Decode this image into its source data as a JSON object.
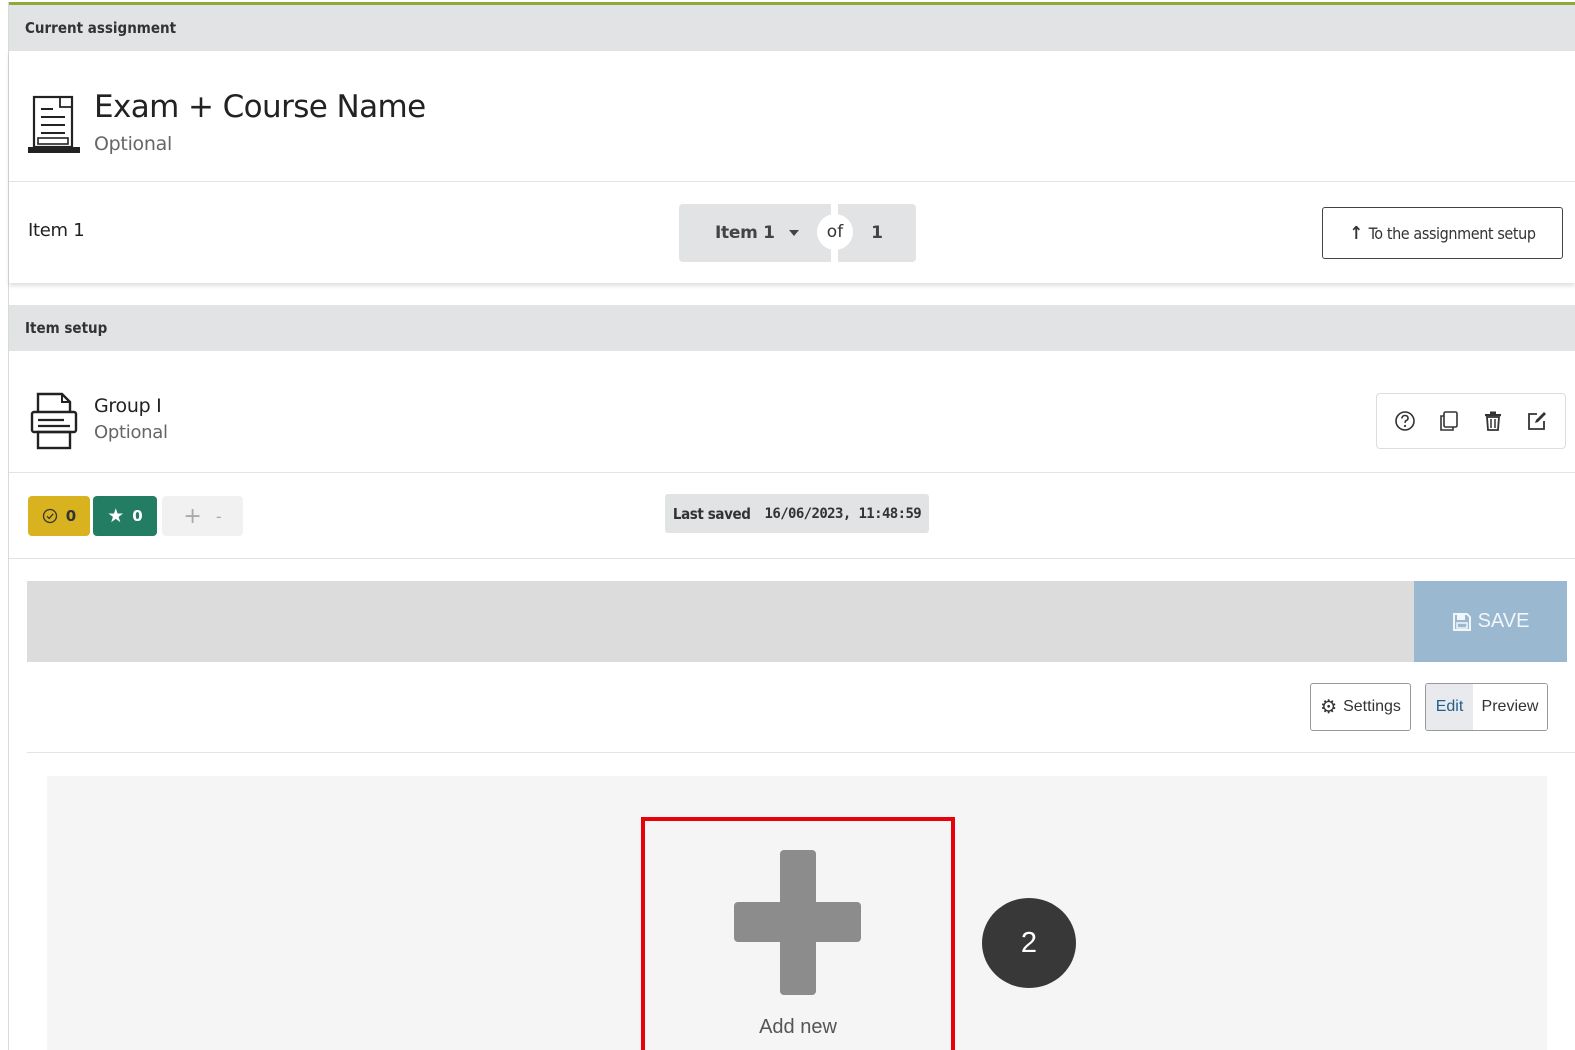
{
  "current_assignment": {
    "section_title": "Current assignment",
    "exam_title": "Exam + Course Name",
    "exam_subtitle": "Optional",
    "exam_icon": "laptop-document-icon",
    "item_label": "Item 1",
    "pager": {
      "selected_item": "Item 1",
      "of_label": "of",
      "total": "1"
    },
    "assignment_setup_button": "To the assignment setup"
  },
  "item_setup": {
    "section_title": "Item setup",
    "group_title": "Group I",
    "group_subtitle": "Optional",
    "group_icon": "printer-icon",
    "toolbar_icons": [
      "help-icon",
      "copy-icon",
      "trash-icon",
      "edit-icon"
    ],
    "badges": {
      "check_count": "0",
      "star_count": "0",
      "add_symbol": "+",
      "remove_symbol": "-"
    },
    "last_saved_label": "Last saved",
    "last_saved_value": "16/06/2023, 11:48:59",
    "save_label": "SAVE",
    "settings_label": "Settings",
    "edit_label": "Edit",
    "preview_label": "Preview",
    "add_new_label": "Add new",
    "step_number": "2"
  },
  "colors": {
    "accent_line": "#8ea83a",
    "badge_yellow": "#d8b31f",
    "badge_green": "#237d62",
    "save_button": "#9ab8d0",
    "highlight_red": "#e8000a",
    "step_badge": "#383838"
  }
}
